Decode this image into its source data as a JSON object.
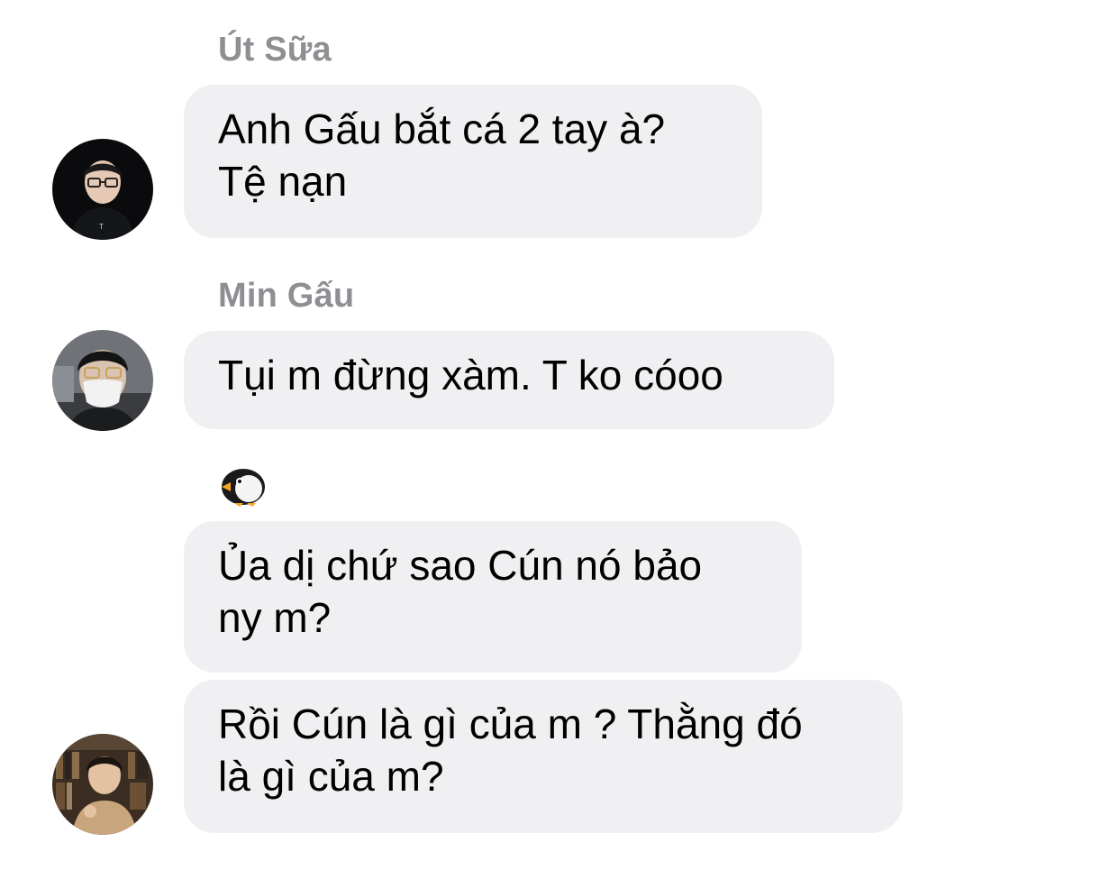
{
  "messages": [
    {
      "sender": "Út Sữa",
      "text": "Anh Gấu bắt cá 2 tay à?\nTệ nạn"
    },
    {
      "sender": "Min Gấu",
      "text": "Tụi m đừng xàm. T ko cóoo"
    },
    {
      "sender_icon": "penguin-emoji",
      "texts": [
        "Ủa dị chứ sao Cún nó bảo\nny m?",
        "Rồi Cún là gì của m ? Thằng đó\nlà gì của m?"
      ]
    }
  ],
  "colors": {
    "bubble_bg": "#f0f0f2",
    "sender_name": "#8e8e93",
    "text": "#000000"
  }
}
